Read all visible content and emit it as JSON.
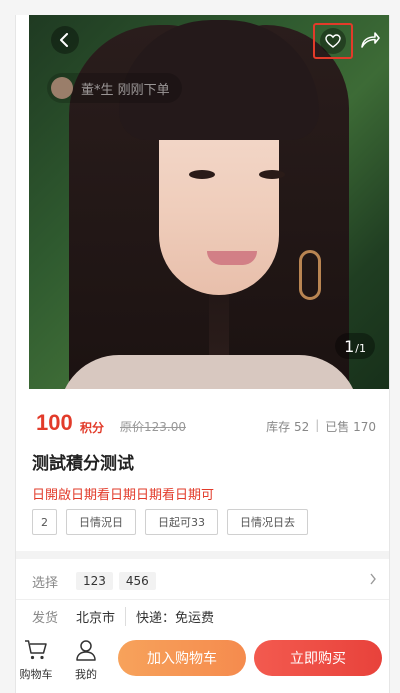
{
  "hero": {
    "buyer_notice": "董*生 刚刚下单",
    "pager_current": "1",
    "pager_total": "/1",
    "icons": {
      "back": "chevron-left-icon",
      "favorite": "heart-outline-icon",
      "share": "share-arrow-icon"
    }
  },
  "product": {
    "price": "100",
    "price_unit": "积分",
    "original_price": "原价123.00",
    "stock": "库存 52",
    "sold": "已售 170",
    "title": "测試積分测试",
    "subtitle": "日開啟日期看日期日期看日期可",
    "tags": [
      "2",
      "日情況日",
      "日起可33",
      "日情况日去"
    ]
  },
  "select": {
    "label": "选择",
    "options": [
      "123",
      "456"
    ]
  },
  "shipping": {
    "label": "发货",
    "city": "北京市",
    "fee": "快递：免运费"
  },
  "bottom_bar": {
    "cart_label": "购物车",
    "mine_label": "我的",
    "add_to_cart": "加入购物车",
    "buy_now": "立即购买"
  },
  "colors": {
    "accent_red": "#e23b2a",
    "cart_orange": "#f7a25b",
    "buy_red": "#f35a4f"
  }
}
